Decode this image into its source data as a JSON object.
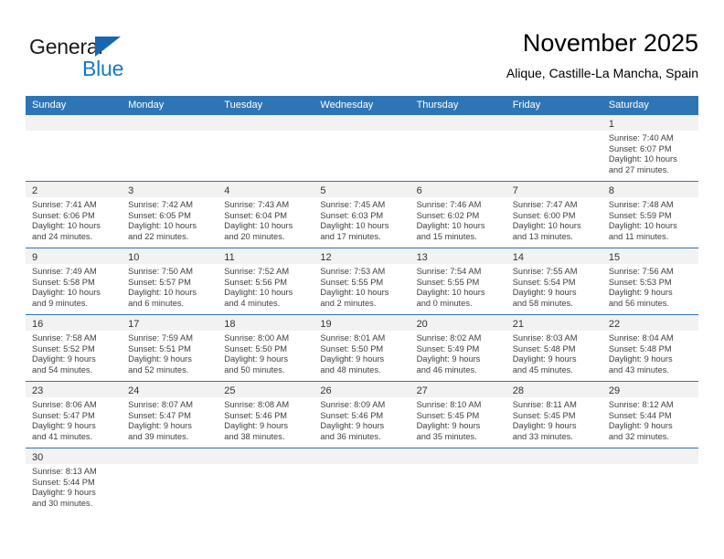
{
  "brand": {
    "name_part1": "General",
    "name_part2": "Blue",
    "accent_color": "#1779c4",
    "triangle_color": "#1667b0"
  },
  "header": {
    "title": "November 2025",
    "subtitle": "Alique, Castille-La Mancha, Spain"
  },
  "calendar": {
    "header_bg": "#2e75b6",
    "weekdays": [
      "Sunday",
      "Monday",
      "Tuesday",
      "Wednesday",
      "Thursday",
      "Friday",
      "Saturday"
    ],
    "weeks": [
      [
        {
          "day": "",
          "lines": []
        },
        {
          "day": "",
          "lines": []
        },
        {
          "day": "",
          "lines": []
        },
        {
          "day": "",
          "lines": []
        },
        {
          "day": "",
          "lines": []
        },
        {
          "day": "",
          "lines": []
        },
        {
          "day": "1",
          "lines": [
            "Sunrise: 7:40 AM",
            "Sunset: 6:07 PM",
            "Daylight: 10 hours",
            "and 27 minutes."
          ]
        }
      ],
      [
        {
          "day": "2",
          "lines": [
            "Sunrise: 7:41 AM",
            "Sunset: 6:06 PM",
            "Daylight: 10 hours",
            "and 24 minutes."
          ]
        },
        {
          "day": "3",
          "lines": [
            "Sunrise: 7:42 AM",
            "Sunset: 6:05 PM",
            "Daylight: 10 hours",
            "and 22 minutes."
          ]
        },
        {
          "day": "4",
          "lines": [
            "Sunrise: 7:43 AM",
            "Sunset: 6:04 PM",
            "Daylight: 10 hours",
            "and 20 minutes."
          ]
        },
        {
          "day": "5",
          "lines": [
            "Sunrise: 7:45 AM",
            "Sunset: 6:03 PM",
            "Daylight: 10 hours",
            "and 17 minutes."
          ]
        },
        {
          "day": "6",
          "lines": [
            "Sunrise: 7:46 AM",
            "Sunset: 6:02 PM",
            "Daylight: 10 hours",
            "and 15 minutes."
          ]
        },
        {
          "day": "7",
          "lines": [
            "Sunrise: 7:47 AM",
            "Sunset: 6:00 PM",
            "Daylight: 10 hours",
            "and 13 minutes."
          ]
        },
        {
          "day": "8",
          "lines": [
            "Sunrise: 7:48 AM",
            "Sunset: 5:59 PM",
            "Daylight: 10 hours",
            "and 11 minutes."
          ]
        }
      ],
      [
        {
          "day": "9",
          "lines": [
            "Sunrise: 7:49 AM",
            "Sunset: 5:58 PM",
            "Daylight: 10 hours",
            "and 9 minutes."
          ]
        },
        {
          "day": "10",
          "lines": [
            "Sunrise: 7:50 AM",
            "Sunset: 5:57 PM",
            "Daylight: 10 hours",
            "and 6 minutes."
          ]
        },
        {
          "day": "11",
          "lines": [
            "Sunrise: 7:52 AM",
            "Sunset: 5:56 PM",
            "Daylight: 10 hours",
            "and 4 minutes."
          ]
        },
        {
          "day": "12",
          "lines": [
            "Sunrise: 7:53 AM",
            "Sunset: 5:55 PM",
            "Daylight: 10 hours",
            "and 2 minutes."
          ]
        },
        {
          "day": "13",
          "lines": [
            "Sunrise: 7:54 AM",
            "Sunset: 5:55 PM",
            "Daylight: 10 hours",
            "and 0 minutes."
          ]
        },
        {
          "day": "14",
          "lines": [
            "Sunrise: 7:55 AM",
            "Sunset: 5:54 PM",
            "Daylight: 9 hours",
            "and 58 minutes."
          ]
        },
        {
          "day": "15",
          "lines": [
            "Sunrise: 7:56 AM",
            "Sunset: 5:53 PM",
            "Daylight: 9 hours",
            "and 56 minutes."
          ]
        }
      ],
      [
        {
          "day": "16",
          "lines": [
            "Sunrise: 7:58 AM",
            "Sunset: 5:52 PM",
            "Daylight: 9 hours",
            "and 54 minutes."
          ]
        },
        {
          "day": "17",
          "lines": [
            "Sunrise: 7:59 AM",
            "Sunset: 5:51 PM",
            "Daylight: 9 hours",
            "and 52 minutes."
          ]
        },
        {
          "day": "18",
          "lines": [
            "Sunrise: 8:00 AM",
            "Sunset: 5:50 PM",
            "Daylight: 9 hours",
            "and 50 minutes."
          ]
        },
        {
          "day": "19",
          "lines": [
            "Sunrise: 8:01 AM",
            "Sunset: 5:50 PM",
            "Daylight: 9 hours",
            "and 48 minutes."
          ]
        },
        {
          "day": "20",
          "lines": [
            "Sunrise: 8:02 AM",
            "Sunset: 5:49 PM",
            "Daylight: 9 hours",
            "and 46 minutes."
          ]
        },
        {
          "day": "21",
          "lines": [
            "Sunrise: 8:03 AM",
            "Sunset: 5:48 PM",
            "Daylight: 9 hours",
            "and 45 minutes."
          ]
        },
        {
          "day": "22",
          "lines": [
            "Sunrise: 8:04 AM",
            "Sunset: 5:48 PM",
            "Daylight: 9 hours",
            "and 43 minutes."
          ]
        }
      ],
      [
        {
          "day": "23",
          "lines": [
            "Sunrise: 8:06 AM",
            "Sunset: 5:47 PM",
            "Daylight: 9 hours",
            "and 41 minutes."
          ]
        },
        {
          "day": "24",
          "lines": [
            "Sunrise: 8:07 AM",
            "Sunset: 5:47 PM",
            "Daylight: 9 hours",
            "and 39 minutes."
          ]
        },
        {
          "day": "25",
          "lines": [
            "Sunrise: 8:08 AM",
            "Sunset: 5:46 PM",
            "Daylight: 9 hours",
            "and 38 minutes."
          ]
        },
        {
          "day": "26",
          "lines": [
            "Sunrise: 8:09 AM",
            "Sunset: 5:46 PM",
            "Daylight: 9 hours",
            "and 36 minutes."
          ]
        },
        {
          "day": "27",
          "lines": [
            "Sunrise: 8:10 AM",
            "Sunset: 5:45 PM",
            "Daylight: 9 hours",
            "and 35 minutes."
          ]
        },
        {
          "day": "28",
          "lines": [
            "Sunrise: 8:11 AM",
            "Sunset: 5:45 PM",
            "Daylight: 9 hours",
            "and 33 minutes."
          ]
        },
        {
          "day": "29",
          "lines": [
            "Sunrise: 8:12 AM",
            "Sunset: 5:44 PM",
            "Daylight: 9 hours",
            "and 32 minutes."
          ]
        }
      ],
      [
        {
          "day": "30",
          "lines": [
            "Sunrise: 8:13 AM",
            "Sunset: 5:44 PM",
            "Daylight: 9 hours",
            "and 30 minutes."
          ]
        },
        {
          "day": "",
          "lines": []
        },
        {
          "day": "",
          "lines": []
        },
        {
          "day": "",
          "lines": []
        },
        {
          "day": "",
          "lines": []
        },
        {
          "day": "",
          "lines": []
        },
        {
          "day": "",
          "lines": []
        }
      ]
    ]
  }
}
